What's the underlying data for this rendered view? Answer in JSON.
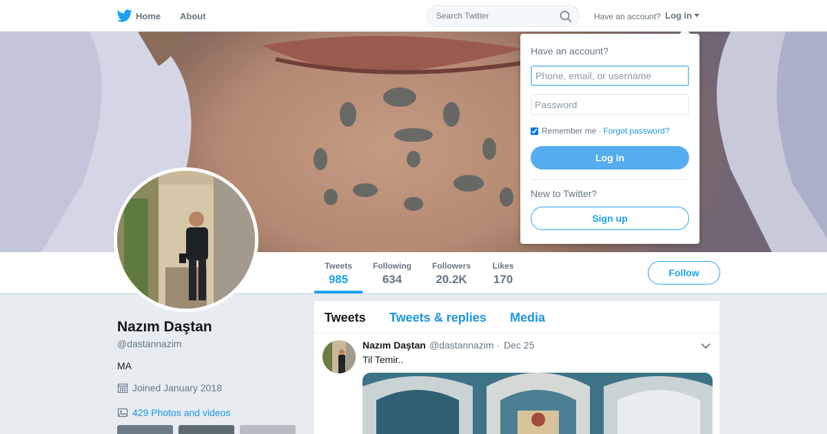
{
  "topbar": {
    "logo_icon": "twitter-bird-icon",
    "home_label": "Home",
    "about_label": "About",
    "search_placeholder": "Search Twitter",
    "have_account_label": "Have an account?",
    "login_label": "Log in"
  },
  "profile": {
    "name": "Nazım Daştan",
    "handle": "@dastannazim",
    "bio": "MA",
    "joined": "Joined January 2018",
    "photos_link": "429 Photos and videos"
  },
  "stats": [
    {
      "label": "Tweets",
      "value": "985",
      "active": true
    },
    {
      "label": "Following",
      "value": "634",
      "active": false
    },
    {
      "label": "Followers",
      "value": "20.2K",
      "active": false
    },
    {
      "label": "Likes",
      "value": "170",
      "active": false
    }
  ],
  "follow_label": "Follow",
  "timeline": {
    "tabs": [
      "Tweets",
      "Tweets & replies",
      "Media"
    ],
    "active_tab": "Tweets",
    "tweet": {
      "name": "Nazım Daştan",
      "handle": "@dastannazim",
      "separator": "·",
      "date": "Dec 25",
      "text": "Til Temir.."
    }
  },
  "login_dropdown": {
    "title": "Have an account?",
    "username_placeholder": "Phone, email, or username",
    "password_placeholder": "Password",
    "remember_label": "Remember me",
    "remember_checked": true,
    "separator": "·",
    "forgot_label": "Forgot password?",
    "login_button": "Log in",
    "new_label": "New to Twitter?",
    "signup_button": "Sign up"
  },
  "colors": {
    "brand_blue": "#1da1f2",
    "link_blue": "#1b95e0",
    "login_button": "#55acee",
    "background": "#e6ecf0"
  }
}
